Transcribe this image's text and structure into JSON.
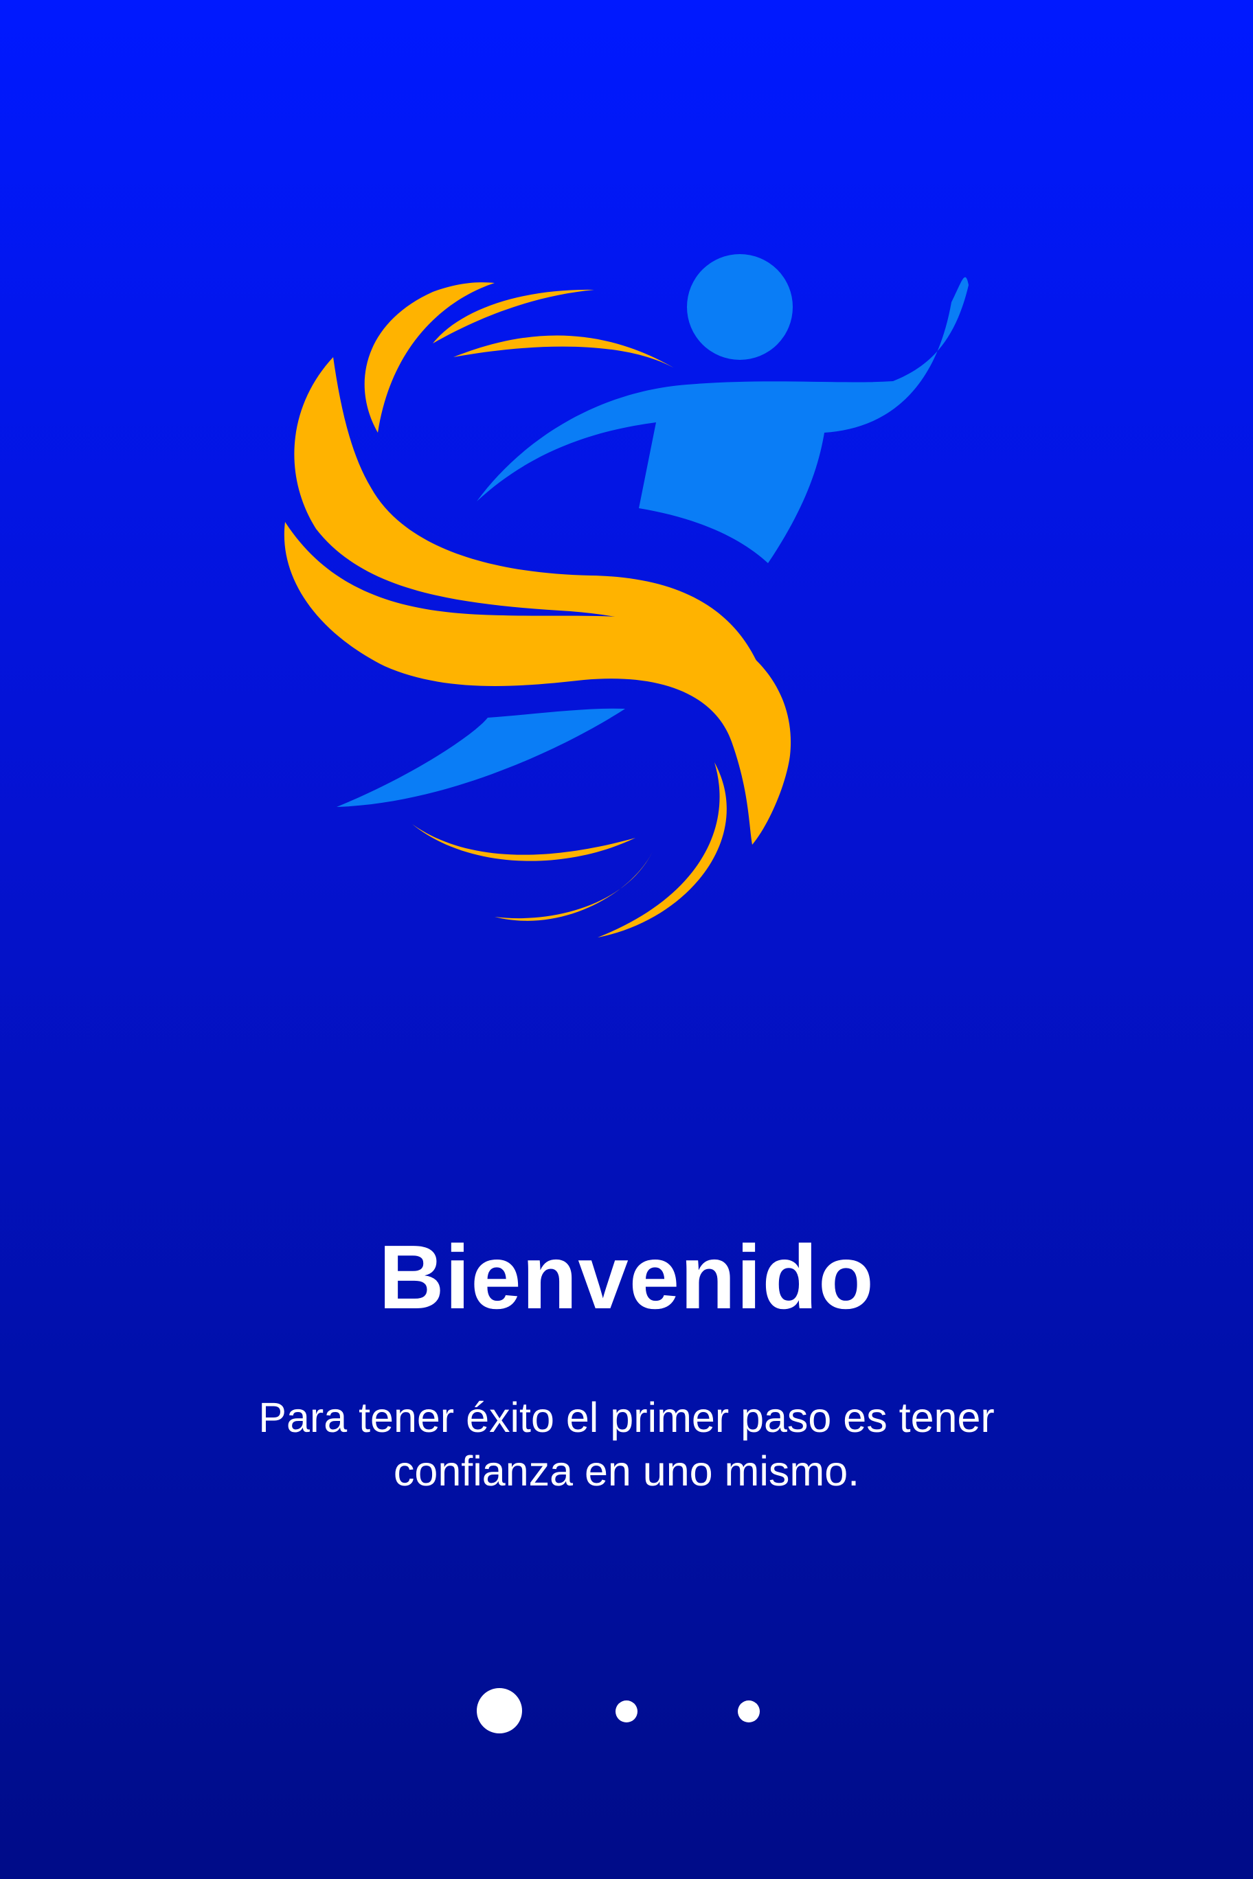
{
  "onboarding": {
    "title": "Bienvenido",
    "subtitle_line1": "Para tener éxito el primer paso es tener",
    "subtitle_line2": "confianza en uno mismo.",
    "logo_icon": "athlete-swoosh-logo-icon",
    "pagination": {
      "total_pages": 3,
      "current_page": 1
    }
  },
  "colors": {
    "background_top": "#0019ff",
    "background_bottom": "#000c88",
    "logo_gold": "#ffb300",
    "logo_blue": "#0a7df6",
    "text": "#ffffff"
  }
}
